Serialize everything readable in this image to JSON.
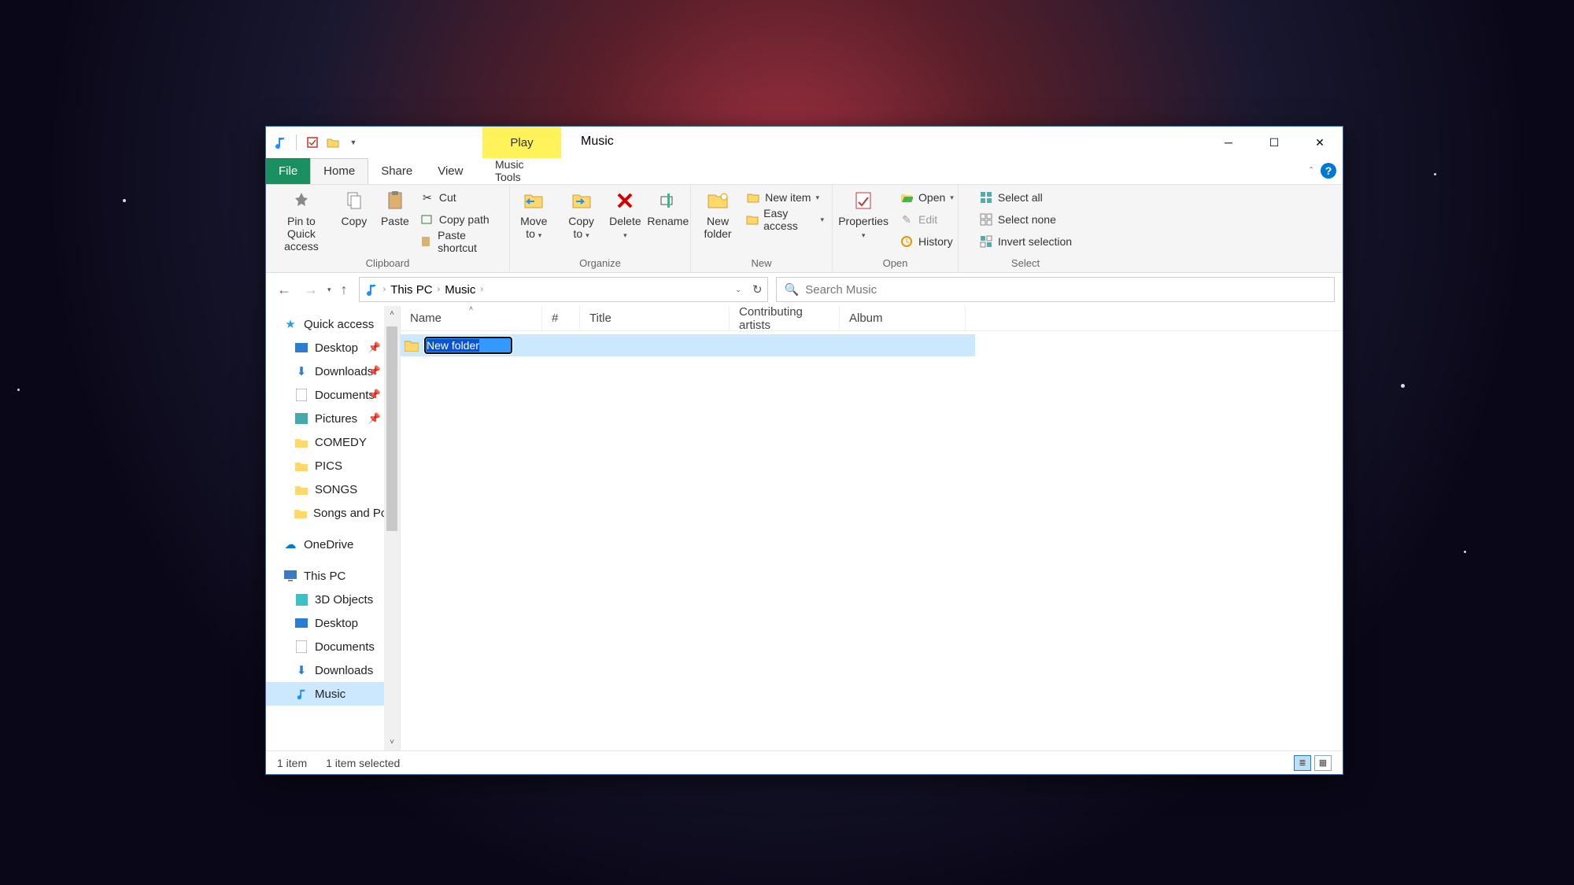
{
  "title": "Music",
  "play_tab": "Play",
  "tabs": {
    "file": "File",
    "home": "Home",
    "share": "Share",
    "view": "View",
    "music_tools": "Music Tools"
  },
  "ribbon": {
    "clipboard": {
      "label": "Clipboard",
      "pin": "Pin to Quick access",
      "copy": "Copy",
      "paste": "Paste",
      "cut": "Cut",
      "copy_path": "Copy path",
      "paste_shortcut": "Paste shortcut"
    },
    "organize": {
      "label": "Organize",
      "move_to": "Move to",
      "copy_to": "Copy to",
      "delete": "Delete",
      "rename": "Rename"
    },
    "new": {
      "label": "New",
      "new_folder": "New folder",
      "new_item": "New item",
      "easy_access": "Easy access"
    },
    "open": {
      "label": "Open",
      "properties": "Properties",
      "open": "Open",
      "edit": "Edit",
      "history": "History"
    },
    "select": {
      "label": "Select",
      "select_all": "Select all",
      "select_none": "Select none",
      "invert": "Invert selection"
    }
  },
  "breadcrumb": {
    "pc": "This PC",
    "music": "Music"
  },
  "search_placeholder": "Search Music",
  "sidebar": {
    "quick_access": "Quick access",
    "desktop": "Desktop",
    "downloads": "Downloads",
    "documents": "Documents",
    "pictures": "Pictures",
    "comedy": "COMEDY",
    "pics": "PICS",
    "songs": "SONGS",
    "songs_poems": "Songs and Poem",
    "onedrive": "OneDrive",
    "this_pc": "This PC",
    "objects3d": "3D Objects",
    "desktop2": "Desktop",
    "documents2": "Documents",
    "downloads2": "Downloads",
    "music": "Music"
  },
  "columns": {
    "name": "Name",
    "num": "#",
    "title": "Title",
    "artists": "Contributing artists",
    "album": "Album"
  },
  "row_input_value": "New folder",
  "status": {
    "count": "1 item",
    "selected": "1 item selected"
  }
}
